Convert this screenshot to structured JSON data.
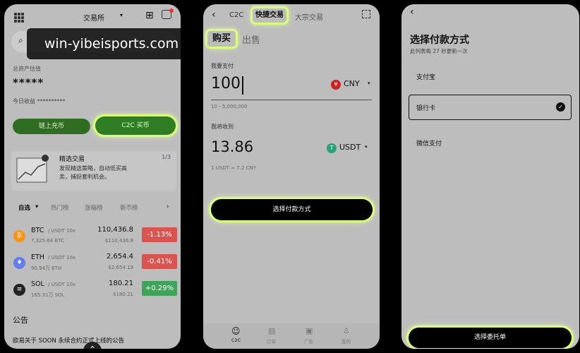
{
  "watermark": "win-yibeisports.com",
  "p1": {
    "header_title": "交易所",
    "hidden_balance_label": "总资产估值",
    "balance_mask": "*****",
    "today_profit": "今日收益 **********",
    "btn_chain": "链上充币",
    "btn_c2c": "C2C 买币",
    "promo_title": "精选交易",
    "promo_page": "1/3",
    "promo_text": "发现精选策略，自动低买高卖，捕捉套利机会。",
    "tabs": [
      "自选",
      "热门榜",
      "涨幅榜",
      "新币榜"
    ],
    "coins": [
      {
        "sym": "BTC",
        "pair": "/ USDT",
        "lev": "10x",
        "sub": "7,325.64 BTC",
        "price": "110,436.8",
        "price_sub": "$110,436.8",
        "pct": "-1.13%",
        "color": "#d9534f",
        "dot": "#f7931a",
        "glyph": "₿"
      },
      {
        "sym": "ETH",
        "pair": "/ USDT",
        "lev": "10x",
        "sub": "90.94万 ETH",
        "price": "2,654.4",
        "price_sub": "$2,654.19",
        "pct": "-0.41%",
        "color": "#d9534f",
        "dot": "#627eea",
        "glyph": "♦"
      },
      {
        "sym": "SOL",
        "pair": "/ USDT",
        "lev": "10x",
        "sub": "165.31万 SOL",
        "price": "180.21",
        "price_sub": "$180.21",
        "pct": "+0.29%",
        "color": "#3fa45a",
        "dot": "#222",
        "glyph": "≡"
      }
    ],
    "announce_title": "公告",
    "announce_text": "欧易关于 SOON 永续合约正式上线的公告"
  },
  "p2": {
    "tabs": [
      "C2C",
      "快捷交易",
      "大宗交易"
    ],
    "buy": "购买",
    "sell": "出售",
    "pay_label": "我要支付",
    "pay_amount": "100",
    "pay_currency": "CNY",
    "pay_range": "10 - 5,000,000",
    "get_label": "我将收到",
    "get_amount": "13.86",
    "get_currency": "USDT",
    "rate": "1 USDT ≈ 7.2 CNY",
    "cta": "选择付款方式",
    "nav": [
      "C2C",
      "订单",
      "广告",
      "我的"
    ]
  },
  "p3": {
    "title": "选择付款方式",
    "subtitle": "此列表每 27 秒更新一次",
    "methods": [
      "支付宝",
      "银行卡",
      "微信支付"
    ],
    "cta": "选择委托单"
  },
  "colors": {
    "accent_green": "#2f7d24",
    "highlight": "#d9ff7a",
    "panel_bg": "#bdbdbd"
  }
}
